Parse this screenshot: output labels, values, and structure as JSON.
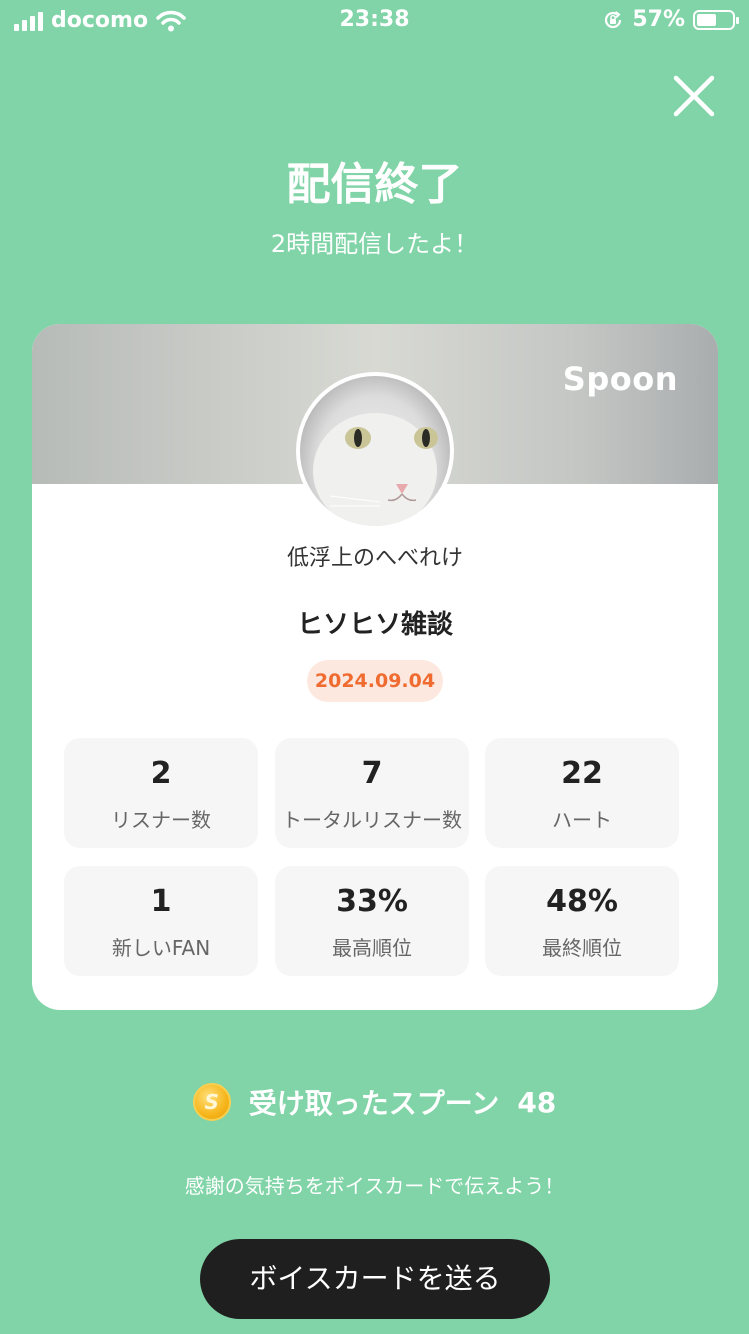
{
  "status_bar": {
    "carrier": "docomo",
    "time": "23:38",
    "battery_percent": "57%",
    "battery_level": 0.57,
    "icons": [
      "signal-icon",
      "wifi-icon",
      "rotation-lock-icon",
      "battery-icon"
    ]
  },
  "header": {
    "close_icon": "close-icon",
    "title": "配信終了",
    "subtitle": "2時間配信したよ！"
  },
  "card": {
    "brand": "Spoon",
    "username": "低浮上のへべれけ",
    "show_title": "ヒソヒソ雑談",
    "date": "2024.09.04",
    "stats": [
      {
        "value": "2",
        "label": "リスナー数"
      },
      {
        "value": "7",
        "label": "トータルリスナー数"
      },
      {
        "value": "22",
        "label": "ハート"
      },
      {
        "value": "1",
        "label": "新しいFAN"
      },
      {
        "value": "33%",
        "label": "最高順位"
      },
      {
        "value": "48%",
        "label": "最終順位"
      }
    ]
  },
  "spoons": {
    "coin_icon": "spoon-coin-icon",
    "coin_letter": "S",
    "label": "受け取ったスプーン",
    "count": "48"
  },
  "footer": {
    "thanks": "感謝の気持ちをボイスカードで伝えよう！",
    "button": "ボイスカードを送る"
  },
  "colors": {
    "background": "#81d4a7",
    "date_badge_bg": "#fde8e0",
    "date_badge_text": "#ef6b30",
    "button_bg": "#1f1f1f"
  }
}
